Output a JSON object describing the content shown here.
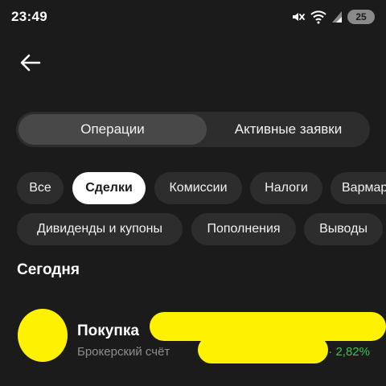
{
  "status_bar": {
    "time": "23:49",
    "icons": [
      "mute-icon",
      "wifi-icon",
      "signal-icon"
    ],
    "battery": "25"
  },
  "header": {
    "back_icon": "arrow-left-icon"
  },
  "tabs": [
    {
      "label": "Операции",
      "active": true
    },
    {
      "label": "Активные заявки",
      "active": false
    }
  ],
  "filters": {
    "row1": [
      "Все",
      "Сделки",
      "Комиссии",
      "Налоги",
      "Вармар"
    ],
    "row2": [
      "Дивиденды и купоны",
      "Пополнения",
      "Выводы"
    ],
    "selected": "Сделки"
  },
  "section": {
    "title": "Сегодня"
  },
  "operations": [
    {
      "title": "Покупка",
      "subtitle": "Брокерский счёт",
      "change": "· 2,82%"
    }
  ],
  "colors": {
    "background": "#1b1b1b",
    "chip": "#2d2d2d",
    "chip_selected": "#ffffff",
    "positive": "#3cc24e",
    "redaction": "#fff200"
  }
}
